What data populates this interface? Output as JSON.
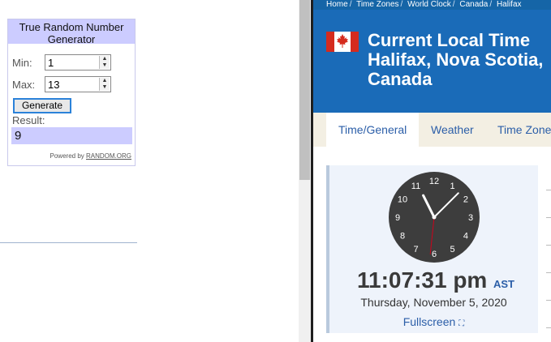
{
  "rng": {
    "title": "True Random Number Generator",
    "min_label": "Min:",
    "min_value": "1",
    "max_label": "Max:",
    "max_value": "13",
    "generate_label": "Generate",
    "result_label": "Result:",
    "result_value": "9",
    "powered_prefix": "Powered by",
    "powered_link": "RANDOM.ORG"
  },
  "breadcrumb": [
    "Home",
    "Time Zones",
    "World Clock",
    "Canada",
    "Halifax"
  ],
  "page": {
    "title_line1": "Current Local Time",
    "title_line2": "Halifax, Nova Scotia,",
    "title_line3": "Canada"
  },
  "tabs": [
    {
      "label": "Time/General",
      "active": true
    },
    {
      "label": "Weather",
      "active": false
    },
    {
      "label": "Time Zone",
      "active": false
    }
  ],
  "clock": {
    "time": "11:07:31 pm",
    "timezone": "AST",
    "date": "Thursday, November 5, 2020",
    "fullscreen_label": "Fullscreen",
    "numbers": [
      "12",
      "1",
      "2",
      "3",
      "4",
      "5",
      "6",
      "7",
      "8",
      "9",
      "10",
      "11"
    ],
    "hour": 11,
    "minute": 7,
    "second": 31
  },
  "colors": {
    "header_blue": "#1a6bb8",
    "link_blue": "#2b5ea8",
    "rng_purple": "#ccccff",
    "second_hand": "#d0021b"
  },
  "icons": {
    "flag": "canada-flag-icon",
    "fullscreen": "expand-icon",
    "spinner": "spin-arrows-icon"
  }
}
